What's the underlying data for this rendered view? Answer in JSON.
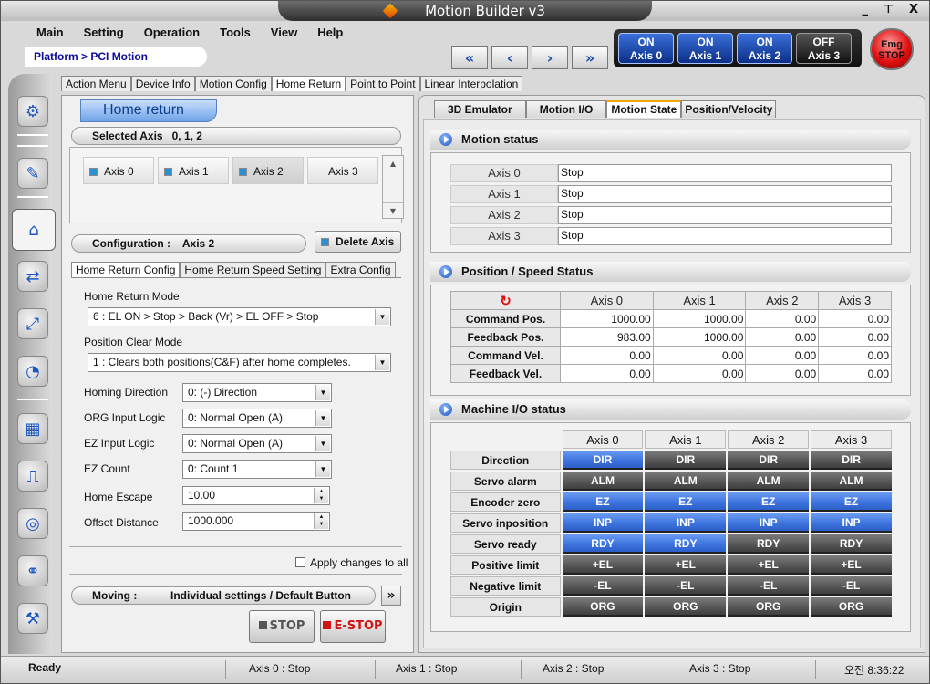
{
  "window": {
    "title": "Motion Builder v3",
    "controls": "_ ⊤ X"
  },
  "menu": [
    "Main",
    "Setting",
    "Operation",
    "Tools",
    "View",
    "Help"
  ],
  "breadcrumb": "Platform > PCI Motion",
  "nav": {
    "first": "«",
    "prev": "‹",
    "next": "›",
    "last": "»"
  },
  "axis_power": [
    {
      "state": "ON",
      "label": "Axis 0"
    },
    {
      "state": "ON",
      "label": "Axis 1"
    },
    {
      "state": "ON",
      "label": "Axis 2"
    },
    {
      "state": "OFF",
      "label": "Axis 3"
    }
  ],
  "emergency": {
    "line1": "Emg",
    "line2": "STOP"
  },
  "sidebar_icons": [
    "motor-icon",
    "tools-icon",
    "home-icon",
    "point-to-point-icon",
    "interpolation-icon",
    "gauge-icon",
    "io-icon",
    "pulse-icon",
    "gear-icon",
    "network-icon",
    "settings-icon"
  ],
  "left_tabs": [
    "Action Menu",
    "Device Info",
    "Motion Config",
    "Home Return",
    "Point to Point",
    "Linear Interpolation"
  ],
  "home_return": {
    "title": "Home return",
    "selected_axis_label": "Selected Axis",
    "selected_axis_value": "0, 1, 2",
    "axes": [
      "Axis 0",
      "Axis 1",
      "Axis 2",
      "Axis 3"
    ],
    "config_label": "Configuration :",
    "config_axis": "Axis 2",
    "delete_axis": "Delete Axis",
    "subtabs": [
      "Home Return Config",
      "Home Return Speed Setting",
      "Extra Config"
    ],
    "fields": {
      "mode_label": "Home Return Mode",
      "mode_value": "6 : EL ON > Stop > Back (Vr) > EL OFF > Stop",
      "clear_label": "Position Clear Mode",
      "clear_value": "1 : Clears both positions(C&F) after home completes.",
      "direction_label": "Homing Direction",
      "direction_value": "0: (-) Direction",
      "org_label": "ORG Input Logic",
      "org_value": "0: Normal Open (A)",
      "ez_label": "EZ Input Logic",
      "ez_value": "0: Normal Open (A)",
      "ezcount_label": "EZ Count",
      "ezcount_value": "0: Count 1",
      "escape_label": "Home Escape",
      "escape_value": "10.00",
      "offset_label": "Offset Distance",
      "offset_value": "1000.000"
    },
    "apply_all": "Apply changes to all",
    "moving_label": "Moving :",
    "moving_value": "Individual settings / Default Button",
    "more": "»",
    "stop": "STOP",
    "estop": "E-STOP"
  },
  "right_tabs": [
    "3D Emulator",
    "Motion I/O",
    "Motion State",
    "Position/Velocity"
  ],
  "motion_status": {
    "title": "Motion status",
    "rows": [
      {
        "axis": "Axis 0",
        "status": "Stop"
      },
      {
        "axis": "Axis 1",
        "status": "Stop"
      },
      {
        "axis": "Axis 2",
        "status": "Stop"
      },
      {
        "axis": "Axis 3",
        "status": "Stop"
      }
    ]
  },
  "position_speed": {
    "title": "Position / Speed Status",
    "headers": [
      "Axis 0",
      "Axis 1",
      "Axis 2",
      "Axis 3"
    ],
    "rows": [
      {
        "label": "Command Pos.",
        "values": [
          "1000.00",
          "1000.00",
          "0.00",
          "0.00"
        ]
      },
      {
        "label": "Feedback Pos.",
        "values": [
          "983.00",
          "1000.00",
          "0.00",
          "0.00"
        ]
      },
      {
        "label": "Command Vel.",
        "values": [
          "0.00",
          "0.00",
          "0.00",
          "0.00"
        ]
      },
      {
        "label": "Feedback Vel.",
        "values": [
          "0.00",
          "0.00",
          "0.00",
          "0.00"
        ]
      }
    ]
  },
  "machine_io": {
    "title": "Machine I/O status",
    "headers": [
      "Axis 0",
      "Axis 1",
      "Axis 2",
      "Axis 3"
    ],
    "rows": [
      {
        "label": "Direction",
        "code": "DIR",
        "on": [
          true,
          false,
          false,
          false
        ]
      },
      {
        "label": "Servo alarm",
        "code": "ALM",
        "on": [
          false,
          false,
          false,
          false
        ]
      },
      {
        "label": "Encoder zero",
        "code": "EZ",
        "on": [
          true,
          true,
          true,
          true
        ]
      },
      {
        "label": "Servo inposition",
        "code": "INP",
        "on": [
          true,
          true,
          true,
          true
        ]
      },
      {
        "label": "Servo ready",
        "code": "RDY",
        "on": [
          true,
          true,
          false,
          false
        ]
      },
      {
        "label": "Positive limit",
        "code": "+EL",
        "on": [
          false,
          false,
          false,
          false
        ]
      },
      {
        "label": "Negative  limit",
        "code": "-EL",
        "on": [
          false,
          false,
          false,
          false
        ]
      },
      {
        "label": "Origin",
        "code": "ORG",
        "on": [
          false,
          false,
          false,
          false
        ]
      }
    ]
  },
  "statusbar": {
    "ready": "Ready",
    "axis0": "Axis 0 :   Stop",
    "axis1": "Axis 1 :   Stop",
    "axis2": "Axis 2 :   Stop",
    "axis3": "Axis 3 :   Stop",
    "time": "오전 8:36:22"
  }
}
